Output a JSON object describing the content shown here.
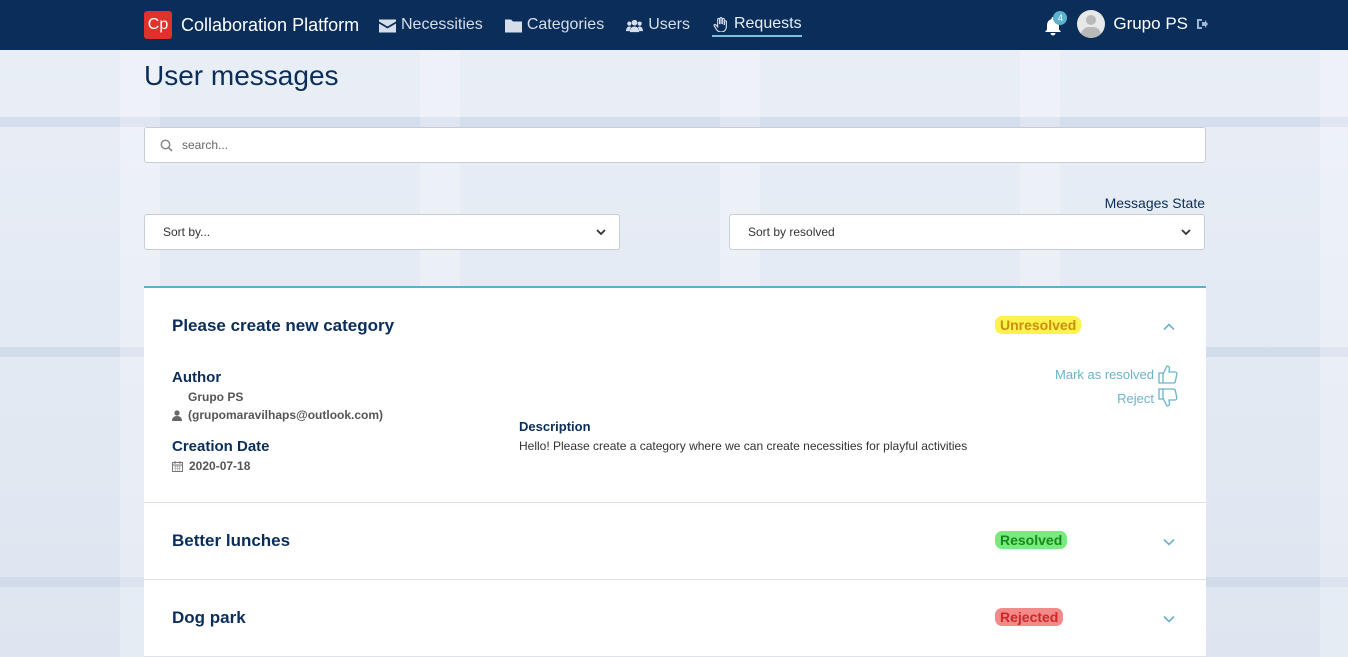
{
  "brand": {
    "logo": "Cp",
    "name": "Collaboration Platform"
  },
  "nav": [
    {
      "label": "Necessities",
      "icon": "envelope-icon"
    },
    {
      "label": "Categories",
      "icon": "folder-icon"
    },
    {
      "label": "Users",
      "icon": "users-icon"
    },
    {
      "label": "Requests",
      "icon": "hand-icon",
      "active": true
    }
  ],
  "user": {
    "name": "Grupo PS",
    "notifications": "4"
  },
  "page": {
    "title": "User messages",
    "search_placeholder": "search...",
    "state_label": "Messages State",
    "sort_by": "Sort by...",
    "sort_resolved": "Sort by resolved"
  },
  "messages": [
    {
      "title": "Please create new category",
      "status": "Unresolved",
      "expanded": true,
      "author_label": "Author",
      "author_name": "Grupo PS",
      "author_email": "(grupomaravilhaps@outlook.com)",
      "date_label": "Creation Date",
      "date": "2020-07-18",
      "description_label": "Description",
      "description": "Hello! Please create a category where we can create necessities for playful activities",
      "mark_resolved": "Mark as resolved",
      "reject": "Reject"
    },
    {
      "title": "Better lunches",
      "status": "Resolved",
      "expanded": false
    },
    {
      "title": "Dog park",
      "status": "Rejected",
      "expanded": false
    }
  ],
  "colors": {
    "navbar": "#0a2d5a",
    "accent": "#5ab1cb",
    "unresolved": "#fff24d",
    "resolved": "#79eb7d",
    "rejected": "#f28a8a"
  }
}
